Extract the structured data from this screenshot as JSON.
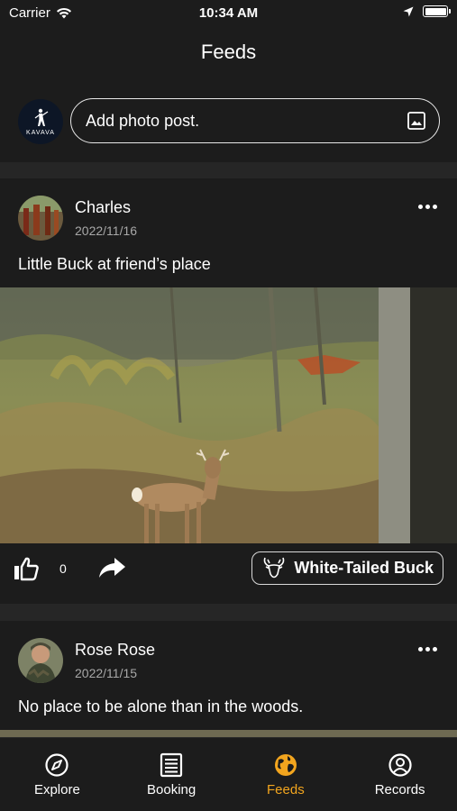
{
  "status_bar": {
    "carrier": "Carrier",
    "time": "10:34 AM"
  },
  "header": {
    "title": "Feeds",
    "logo_text": "KAVAVA",
    "add_post_placeholder": "Add photo post."
  },
  "posts": [
    {
      "author": "Charles",
      "date": "2022/11/16",
      "caption": "Little Buck at friend’s place",
      "likes": "0",
      "species": "White-Tailed Buck"
    },
    {
      "author": "Rose Rose",
      "date": "2022/11/15",
      "caption": "No place to be alone than in the woods."
    }
  ],
  "tabs": [
    {
      "label": "Explore",
      "icon": "compass-icon"
    },
    {
      "label": "Booking",
      "icon": "list-icon"
    },
    {
      "label": "Feeds",
      "icon": "globe-icon"
    },
    {
      "label": "Records",
      "icon": "user-circle-icon"
    }
  ],
  "colors": {
    "accent": "#f2a51e",
    "background": "#121212",
    "surface": "#1c1c1c"
  }
}
